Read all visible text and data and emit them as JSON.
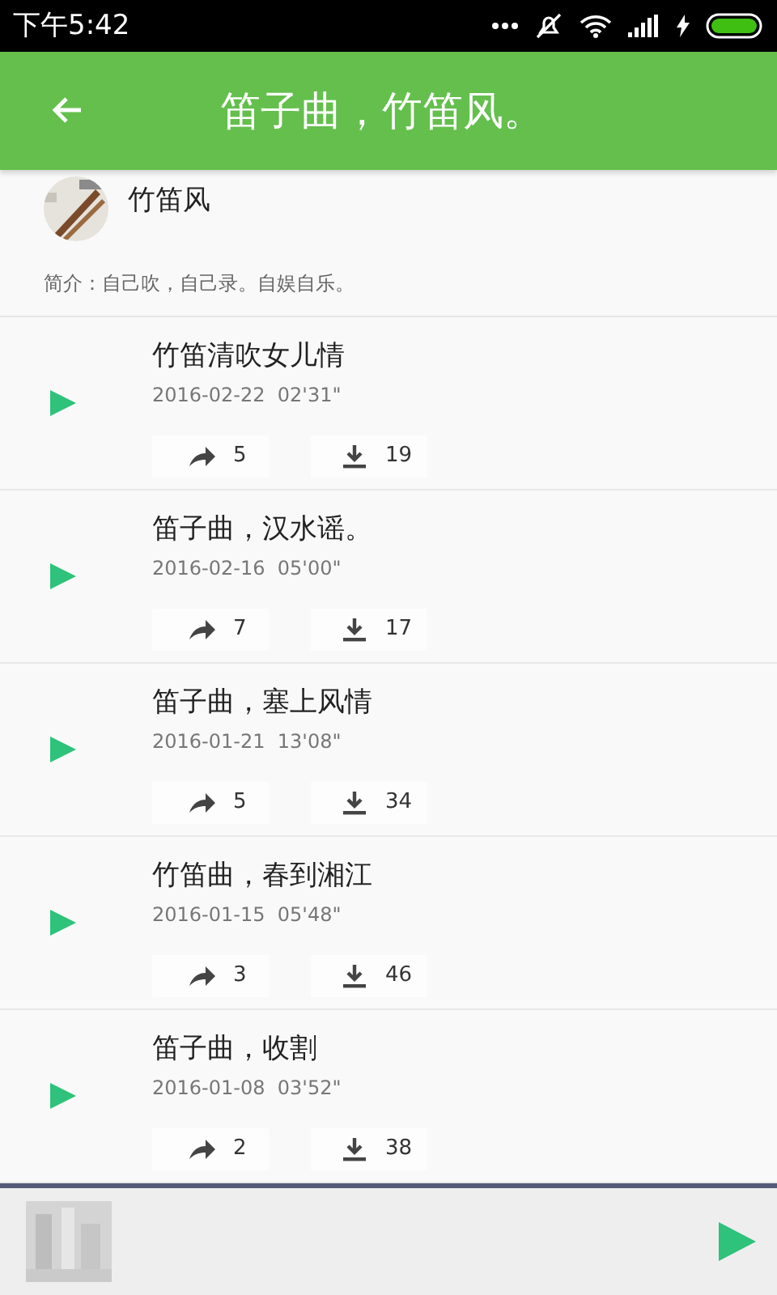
{
  "status_bar": {
    "time": "下午5:42"
  },
  "app_bar": {
    "title": "笛子曲，竹笛风。"
  },
  "profile": {
    "name": "竹笛风",
    "intro": "简介：自己吹，自己录。自娱自乐。"
  },
  "tracks": [
    {
      "title": "竹笛清吹女儿情",
      "date": "2016-02-22",
      "duration": "02'31\"",
      "shares": "5",
      "downloads": "19"
    },
    {
      "title": "笛子曲，汉水谣。",
      "date": "2016-02-16",
      "duration": "05'00\"",
      "shares": "7",
      "downloads": "17"
    },
    {
      "title": "笛子曲，塞上风情",
      "date": "2016-01-21",
      "duration": "13'08\"",
      "shares": "5",
      "downloads": "34"
    },
    {
      "title": "竹笛曲，春到湘江",
      "date": "2016-01-15",
      "duration": "05'48\"",
      "shares": "3",
      "downloads": "46"
    },
    {
      "title": "笛子曲，收割",
      "date": "2016-01-08",
      "duration": "03'52\"",
      "shares": "2",
      "downloads": "38"
    }
  ]
}
